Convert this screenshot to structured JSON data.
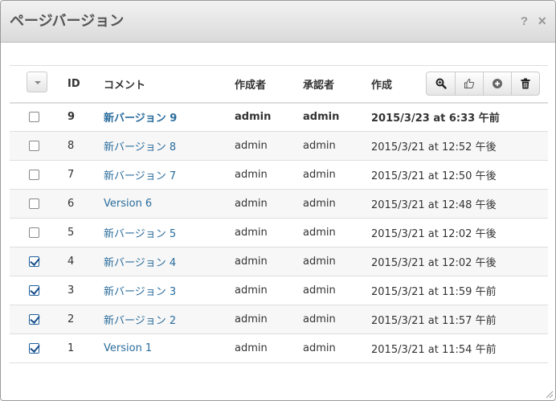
{
  "window": {
    "title": "ページバージョン",
    "help_symbol": "?",
    "close_symbol": "×"
  },
  "table": {
    "headers": {
      "id": "ID",
      "comment": "コメント",
      "author": "作成者",
      "approver": "承認者",
      "created": "作成"
    },
    "toolbar_icons": [
      "magnify-icon",
      "thumbs-up-icon",
      "plus-circle-icon",
      "trash-icon"
    ],
    "rows": [
      {
        "checked": false,
        "id": "9",
        "comment": "新バージョン 9",
        "author": "admin",
        "approver": "admin",
        "created": "2015/3/23 at 6:33 午前"
      },
      {
        "checked": false,
        "id": "8",
        "comment": "新バージョン 8",
        "author": "admin",
        "approver": "admin",
        "created": "2015/3/21 at 12:52 午後"
      },
      {
        "checked": false,
        "id": "7",
        "comment": "新バージョン 7",
        "author": "admin",
        "approver": "admin",
        "created": "2015/3/21 at 12:50 午後"
      },
      {
        "checked": false,
        "id": "6",
        "comment": "Version 6",
        "author": "admin",
        "approver": "admin",
        "created": "2015/3/21 at 12:48 午後"
      },
      {
        "checked": false,
        "id": "5",
        "comment": "新バージョン 5",
        "author": "admin",
        "approver": "admin",
        "created": "2015/3/21 at 12:02 午後"
      },
      {
        "checked": true,
        "id": "4",
        "comment": "新バージョン 4",
        "author": "admin",
        "approver": "admin",
        "created": "2015/3/21 at 12:02 午後"
      },
      {
        "checked": true,
        "id": "3",
        "comment": "新バージョン 3",
        "author": "admin",
        "approver": "admin",
        "created": "2015/3/21 at 11:59 午前"
      },
      {
        "checked": true,
        "id": "2",
        "comment": "新バージョン 2",
        "author": "admin",
        "approver": "admin",
        "created": "2015/3/21 at 11:57 午前"
      },
      {
        "checked": true,
        "id": "1",
        "comment": "Version 1",
        "author": "admin",
        "approver": "admin",
        "created": "2015/3/21 at 11:54 午前"
      }
    ]
  },
  "colors": {
    "link": "#2a6c9c",
    "checkmark": "#1a4f8b"
  }
}
